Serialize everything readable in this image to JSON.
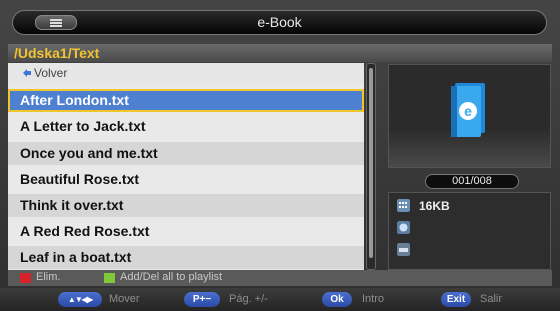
{
  "header": {
    "title": "e-Book",
    "menu_icon": "list-icon"
  },
  "path": "/Udska1/Text",
  "list": {
    "back_label": "Volver",
    "files": [
      "After London.txt",
      "A Letter to Jack.txt",
      "Once you and me.txt",
      "Beautiful Rose.txt",
      "Think it over.txt",
      "A Red Red Rose.txt",
      "Leaf in a boat.txt"
    ]
  },
  "preview": {
    "icon": "ebook-icon",
    "badge": "e"
  },
  "counter": "001/008",
  "info": {
    "size": "16KB"
  },
  "legend": {
    "red_label": "Elim.",
    "green_label": "Add/Del all to playlist",
    "red_color": "#d8222a",
    "green_color": "#7ec83a"
  },
  "footer": {
    "move_key": "▲▼◀▶",
    "move_label": "Mover",
    "page_key": "P+−",
    "page_label": "Pág. +/-",
    "ok_key": "Ok",
    "ok_label": "Intro",
    "exit_key": "Exit",
    "exit_label": "Salir"
  },
  "colors": {
    "accent": "#f3c330",
    "selection": "#4e80d2",
    "key": "#3a5cc0"
  }
}
